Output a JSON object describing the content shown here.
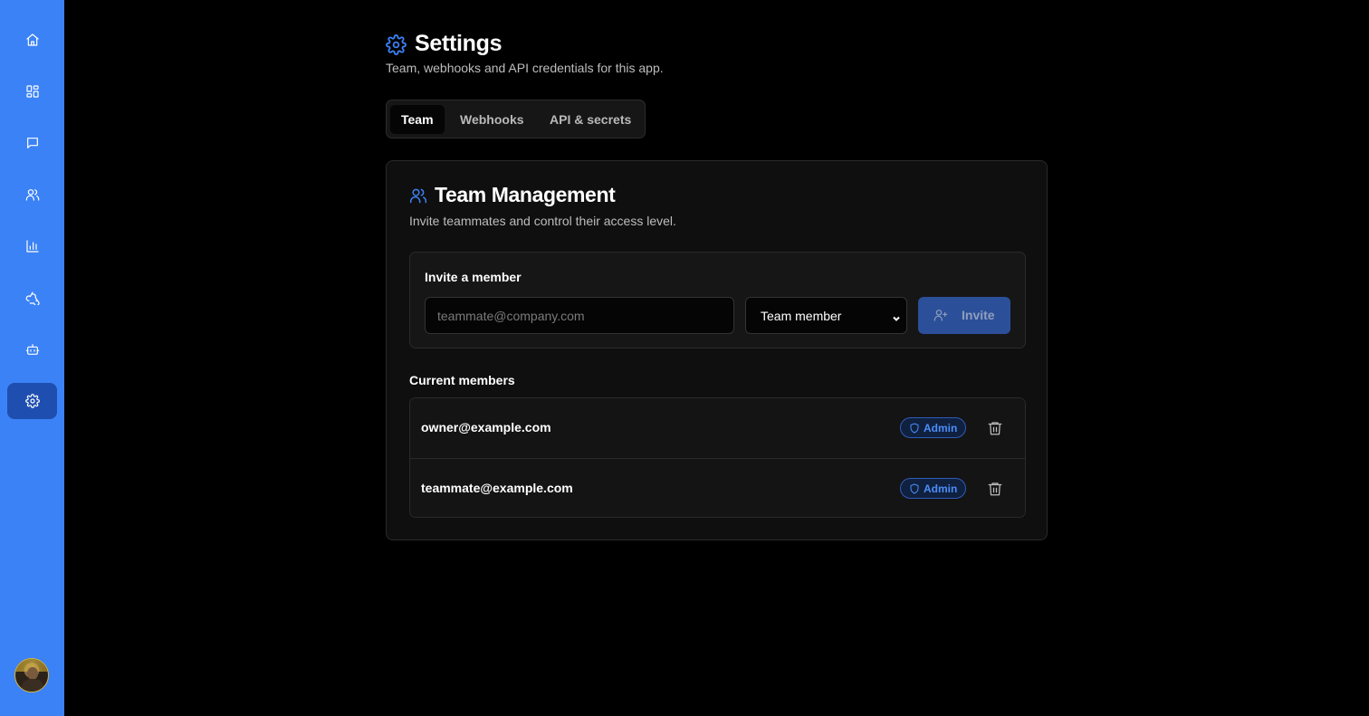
{
  "sidebar": {
    "items": [
      {
        "icon": "home-icon",
        "active": false
      },
      {
        "icon": "dashboard-grid-icon",
        "active": false
      },
      {
        "icon": "chat-icon",
        "active": false
      },
      {
        "icon": "users-icon",
        "active": false
      },
      {
        "icon": "bar-chart-icon",
        "active": false
      },
      {
        "icon": "webhook-icon",
        "active": false
      },
      {
        "icon": "bot-icon",
        "active": false
      },
      {
        "icon": "gear-icon",
        "active": true
      }
    ],
    "active_color": "#1e4fb0",
    "background": "#3b82f6"
  },
  "header": {
    "title": "Settings",
    "subtitle": "Team, webhooks and API credentials for this app."
  },
  "tabs": [
    {
      "label": "Team",
      "active": true
    },
    {
      "label": "Webhooks",
      "active": false
    },
    {
      "label": "API & secrets",
      "active": false
    }
  ],
  "team": {
    "title": "Team Management",
    "description": "Invite teammates and control their access level.",
    "invite": {
      "label": "Invite a member",
      "email_placeholder": "teammate@company.com",
      "email_value": "",
      "role_selected": "Team member",
      "button_label": "Invite"
    },
    "members_label": "Current members",
    "members": [
      {
        "email": "owner@example.com",
        "role": "Admin"
      },
      {
        "email": "teammate@example.com",
        "role": "Admin"
      }
    ]
  },
  "colors": {
    "accent": "#3b82f6",
    "badge_text": "#4b8ef7",
    "invite_button_disabled": "#2c4f9a"
  }
}
